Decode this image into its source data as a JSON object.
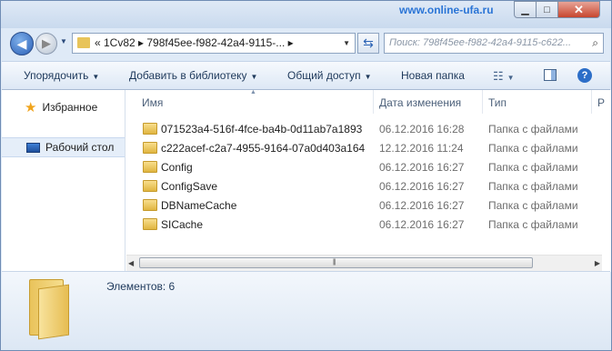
{
  "window": {
    "watermark": "www.online-ufa.ru",
    "controls": {
      "minimize": "▁",
      "maximize": "□",
      "close": "✕"
    }
  },
  "nav": {
    "back_icon": "back-arrow-icon",
    "forward_icon": "forward-arrow-icon",
    "address_path": "«  1Cv82  ▸  798f45ee-f982-42a4-9115-...  ▸",
    "search_placeholder": "Поиск: 798f45ee-f982-42a4-9115-c622..."
  },
  "toolbar": {
    "organize": "Упорядочить",
    "add_to_library": "Добавить в библиотеку",
    "share": "Общий доступ",
    "new_folder": "Новая папка"
  },
  "sidebar": {
    "items": [
      {
        "label": "Избранное",
        "icon": "star-icon"
      },
      {
        "label": "Рабочий стол",
        "icon": "desktop-icon"
      }
    ]
  },
  "columns": {
    "name": "Имя",
    "date": "Дата изменения",
    "type": "Тип",
    "extra": "Р"
  },
  "files": [
    {
      "name": "071523a4-516f-4fce-ba4b-0d11ab7a1893",
      "date": "06.12.2016 16:28",
      "type": "Папка с файлами"
    },
    {
      "name": "c222acef-c2a7-4955-9164-07a0d403a164",
      "date": "12.12.2016 11:24",
      "type": "Папка с файлами"
    },
    {
      "name": "Config",
      "date": "06.12.2016 16:27",
      "type": "Папка с файлами"
    },
    {
      "name": "ConfigSave",
      "date": "06.12.2016 16:27",
      "type": "Папка с файлами"
    },
    {
      "name": "DBNameCache",
      "date": "06.12.2016 16:27",
      "type": "Папка с файлами"
    },
    {
      "name": "SICache",
      "date": "06.12.2016 16:27",
      "type": "Папка с файлами"
    }
  ],
  "details": {
    "count_label": "Элементов: 6"
  },
  "colors": {
    "accent": "#2b75d6",
    "folder": "#e8c45a",
    "close": "#c7462e"
  }
}
